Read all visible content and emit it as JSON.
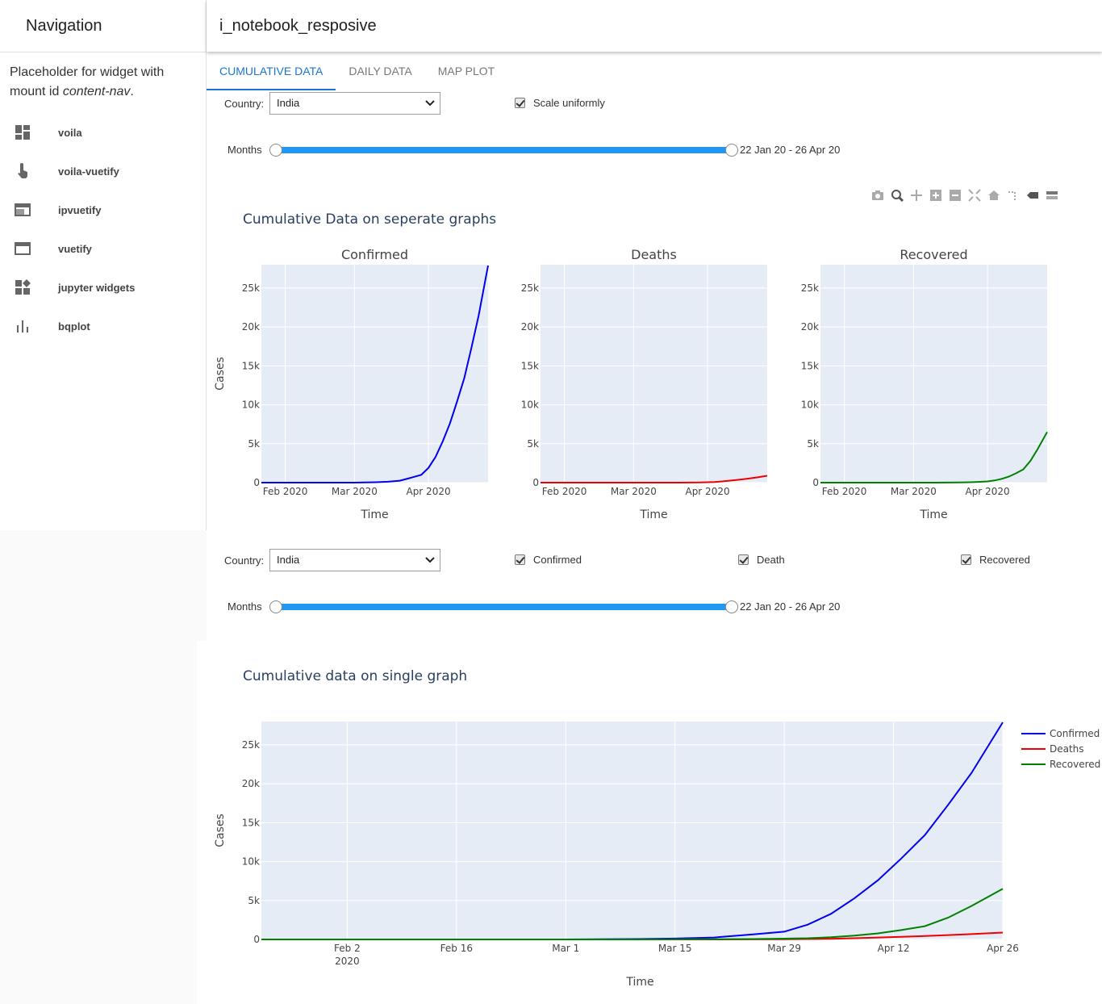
{
  "app": {
    "header_title": "i_notebook_resposive"
  },
  "sidebar": {
    "title": "Navigation",
    "placeholder_text": "Placeholder for widget with mount id ",
    "placeholder_mount_id": "content-nav",
    "placeholder_suffix": ".",
    "items": [
      {
        "label": "voila",
        "icon": "dashboard-icon"
      },
      {
        "label": "voila-vuetify",
        "icon": "touch-icon"
      },
      {
        "label": "ipvuetify",
        "icon": "web-window-icon"
      },
      {
        "label": "vuetify",
        "icon": "web-window-icon"
      },
      {
        "label": "jupyter widgets",
        "icon": "widgets-icon"
      },
      {
        "label": "bqplot",
        "icon": "bar-chart-icon"
      }
    ]
  },
  "tabs": [
    {
      "label": "CUMULATIVE DATA",
      "active": true
    },
    {
      "label": "DAILY DATA",
      "active": false
    },
    {
      "label": "MAP PLOT",
      "active": false
    }
  ],
  "section1": {
    "country_label": "Country:",
    "country_value": "India",
    "scale_label": "Scale uniformly",
    "scale_checked": true,
    "months_label": "Months",
    "range_readout": "22 Jan 20 - 26 Apr 20",
    "plot_title": "Cumulative Data on seperate graphs"
  },
  "section2": {
    "country_label": "Country:",
    "country_value": "India",
    "confirmed_label": "Confirmed",
    "death_label": "Death",
    "recovered_label": "Recovered",
    "months_label": "Months",
    "range_readout": "22 Jan 20 - 26 Apr 20",
    "plot_title": "Cumulative data on single graph"
  },
  "colors": {
    "confirmed": "#0000ee",
    "deaths": "#ee0000",
    "recovered": "#008000",
    "plot_bg": "#e5ecf6",
    "accent": "#1976d2"
  },
  "chart_data": [
    {
      "type": "line",
      "subplots": [
        {
          "title": "Confirmed",
          "color": "#0000ee"
        },
        {
          "title": "Deaths",
          "color": "#ee0000"
        },
        {
          "title": "Recovered",
          "color": "#008000"
        }
      ],
      "xlabel": "Time",
      "ylabel": "Cases",
      "x_ticks": [
        "Feb 2020",
        "Mar 2020",
        "Apr 2020"
      ],
      "y_ticks": [
        "0",
        "5k",
        "10k",
        "15k",
        "20k",
        "25k"
      ],
      "ylim": [
        0,
        28000
      ],
      "x_dates": [
        "2020-01-22",
        "2020-02-01",
        "2020-02-15",
        "2020-03-01",
        "2020-03-10",
        "2020-03-15",
        "2020-03-20",
        "2020-03-25",
        "2020-03-29",
        "2020-04-01",
        "2020-04-04",
        "2020-04-07",
        "2020-04-10",
        "2020-04-13",
        "2020-04-16",
        "2020-04-19",
        "2020-04-22",
        "2020-04-26"
      ],
      "confirmed": [
        0,
        1,
        3,
        3,
        50,
        110,
        250,
        650,
        1000,
        1900,
        3300,
        5300,
        7600,
        10400,
        13400,
        17300,
        21400,
        27900
      ],
      "deaths": [
        0,
        0,
        0,
        0,
        1,
        2,
        5,
        12,
        25,
        50,
        80,
        160,
        250,
        340,
        440,
        560,
        680,
        880
      ],
      "recovered": [
        0,
        0,
        3,
        3,
        5,
        15,
        25,
        50,
        100,
        160,
        280,
        490,
        780,
        1200,
        1700,
        2800,
        4300,
        6500
      ]
    },
    {
      "type": "line",
      "series": [
        {
          "name": "Confirmed",
          "color": "#0000ee"
        },
        {
          "name": "Deaths",
          "color": "#ee0000"
        },
        {
          "name": "Recovered",
          "color": "#008000"
        }
      ],
      "xlabel": "Time",
      "ylabel": "Cases",
      "x_ticks": [
        "Feb 2\n2020",
        "Feb 16",
        "Mar 1",
        "Mar 15",
        "Mar 29",
        "Apr 12",
        "Apr 26"
      ],
      "y_ticks": [
        "0",
        "5k",
        "10k",
        "15k",
        "20k",
        "25k"
      ],
      "ylim": [
        0,
        28000
      ],
      "legend": "right"
    }
  ]
}
